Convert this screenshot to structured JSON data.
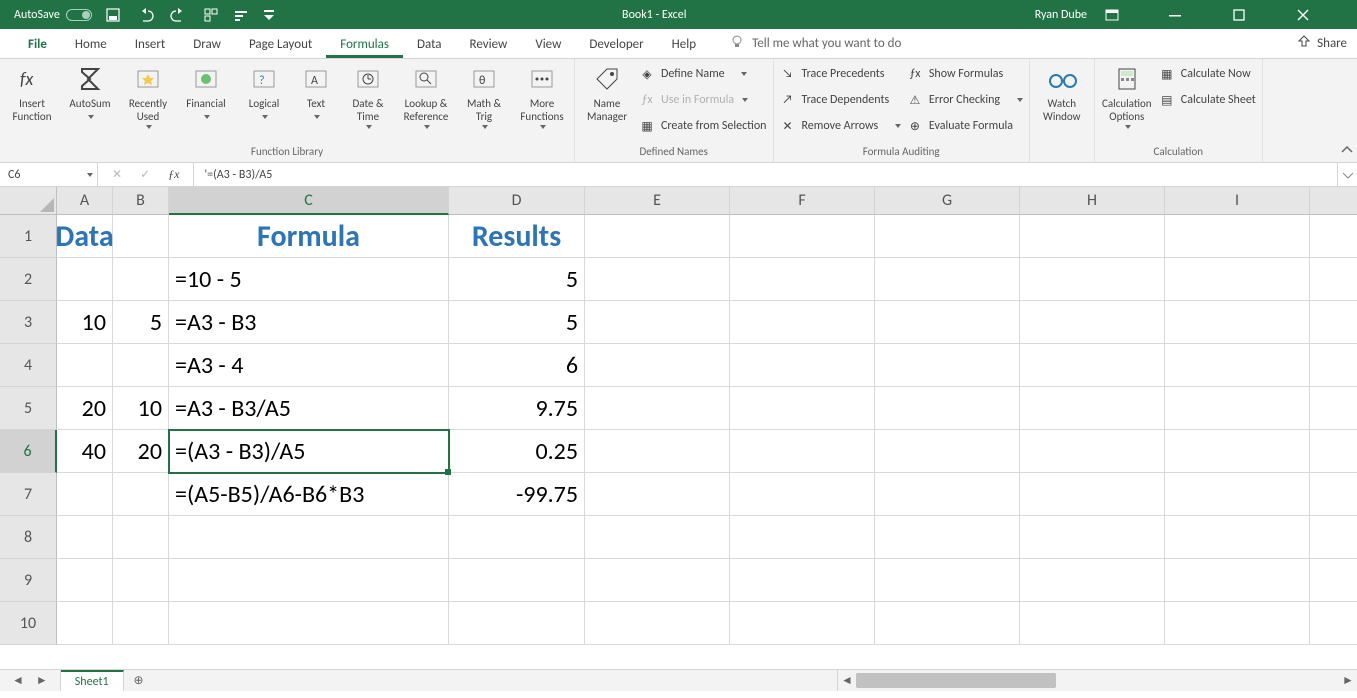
{
  "titlebar": {
    "autosave_label": "AutoSave",
    "doc_title": "Book1  -  Excel",
    "user_name": "Ryan Dube"
  },
  "tabs": {
    "file": "File",
    "items": [
      "Home",
      "Insert",
      "Draw",
      "Page Layout",
      "Formulas",
      "Data",
      "Review",
      "View",
      "Developer",
      "Help"
    ],
    "active_index": 4,
    "tell_me": "Tell me what you want to do",
    "share": "Share"
  },
  "ribbon": {
    "groups": {
      "function_library": {
        "label": "Function Library",
        "buttons": [
          "Insert\nFunction",
          "AutoSum",
          "Recently\nUsed",
          "Financial",
          "Logical",
          "Text",
          "Date &\nTime",
          "Lookup &\nReference",
          "Math &\nTrig",
          "More\nFunctions"
        ]
      },
      "defined_names": {
        "label": "Defined Names",
        "big": "Name\nManager",
        "cmds": [
          "Define Name",
          "Use in Formula",
          "Create from Selection"
        ]
      },
      "formula_auditing": {
        "label": "Formula Auditing",
        "col1": [
          "Trace Precedents",
          "Trace Dependents",
          "Remove Arrows"
        ],
        "col2": [
          "Show Formulas",
          "Error Checking",
          "Evaluate Formula"
        ]
      },
      "watch": {
        "big": "Watch\nWindow"
      },
      "calculation": {
        "label": "Calculation",
        "big": "Calculation\nOptions",
        "cmds": [
          "Calculate Now",
          "Calculate Sheet"
        ]
      }
    }
  },
  "formula_bar": {
    "name_box": "C6",
    "formula": "'=(A3 - B3)/A5"
  },
  "sheet": {
    "columns": [
      "A",
      "B",
      "C",
      "D",
      "E",
      "F",
      "G",
      "H",
      "I"
    ],
    "rows": [
      "1",
      "2",
      "3",
      "4",
      "5",
      "6",
      "7",
      "8",
      "9",
      "10"
    ],
    "active_col_index": 2,
    "active_row_index": 5,
    "headers": {
      "A1": "Data",
      "C1": "Formula",
      "D1": "Results"
    },
    "data": {
      "A3": "10",
      "B3": "5",
      "A5": "20",
      "B5": "10",
      "A6": "40",
      "B6": "20",
      "C2": "=10 - 5",
      "C3": "=A3 - B3",
      "C4": "=A3 - 4",
      "C5": "=A3 - B3/A5",
      "C6": "=(A3 - B3)/A5",
      "C7": "=(A5-B5)/A6-B6*B3",
      "D2": "5",
      "D3": "5",
      "D4": "6",
      "D5": "9.75",
      "D6": "0.25",
      "D7": "-99.75"
    },
    "tab_name": "Sheet1"
  }
}
